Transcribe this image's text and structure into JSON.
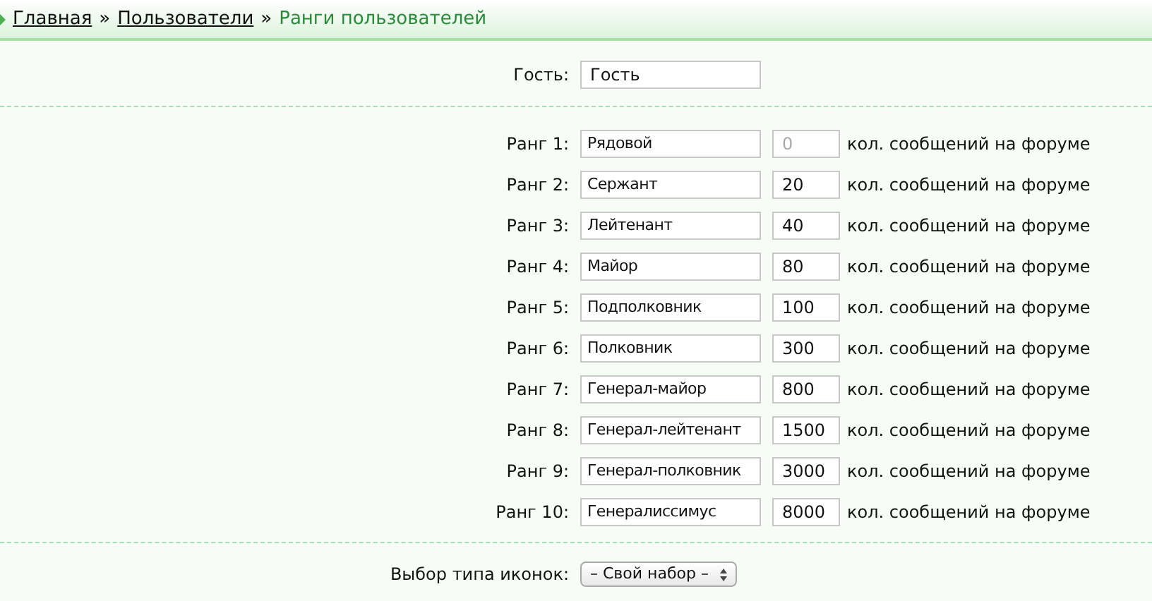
{
  "breadcrumb": [
    {
      "label": "Главная",
      "kind": "link"
    },
    {
      "label": "Пользователи",
      "kind": "link"
    },
    {
      "label": "Ранги пользователей",
      "kind": "current"
    }
  ],
  "separator": "»",
  "guest": {
    "label": "Гость:",
    "value": "Гость"
  },
  "ranks": [
    {
      "label": "Ранг 1:",
      "name": "Рядовой",
      "count": "0",
      "disabled": true,
      "suffix": "кол. сообщений на форуме"
    },
    {
      "label": "Ранг 2:",
      "name": "Сержант",
      "count": "20",
      "disabled": false,
      "suffix": "кол. сообщений на форуме"
    },
    {
      "label": "Ранг 3:",
      "name": "Лейтенант",
      "count": "40",
      "disabled": false,
      "suffix": "кол. сообщений на форуме"
    },
    {
      "label": "Ранг 4:",
      "name": "Майор",
      "count": "80",
      "disabled": false,
      "suffix": "кол. сообщений на форуме"
    },
    {
      "label": "Ранг 5:",
      "name": "Подполковник",
      "count": "100",
      "disabled": false,
      "suffix": "кол. сообщений на форуме"
    },
    {
      "label": "Ранг 6:",
      "name": "Полковник",
      "count": "300",
      "disabled": false,
      "suffix": "кол. сообщений на форуме"
    },
    {
      "label": "Ранг 7:",
      "name": "Генерал-майор",
      "count": "800",
      "disabled": false,
      "suffix": "кол. сообщений на форуме"
    },
    {
      "label": "Ранг 8:",
      "name": "Генерал-лейтенант",
      "count": "1500",
      "disabled": false,
      "suffix": "кол. сообщений на форуме"
    },
    {
      "label": "Ранг 9:",
      "name": "Генерал-полковник",
      "count": "3000",
      "disabled": false,
      "suffix": "кол. сообщений на форуме"
    },
    {
      "label": "Ранг 10:",
      "name": "Генералиссимус",
      "count": "8000",
      "disabled": false,
      "suffix": "кол. сообщений на форуме"
    }
  ],
  "icon_type": {
    "label": "Выбор типа иконок:",
    "value": "– Свой набор –"
  }
}
